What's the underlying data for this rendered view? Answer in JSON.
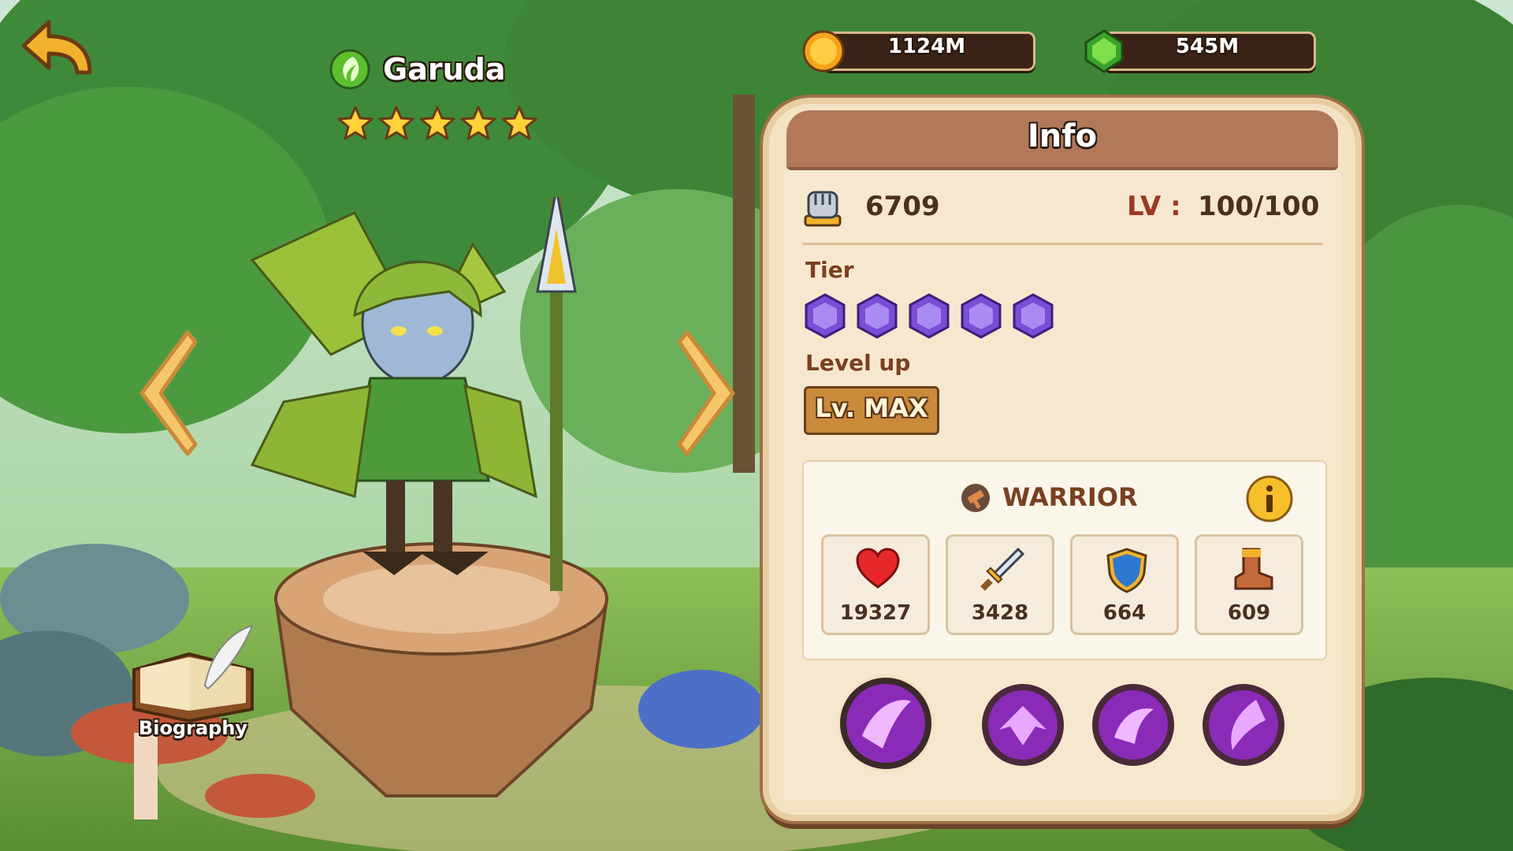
{
  "hero": {
    "name": "Garuda",
    "stars": 5,
    "element_icon": "nature-leaf-icon"
  },
  "currency": {
    "gold": "1124M",
    "gems": "545M"
  },
  "biography": {
    "label": "Biography"
  },
  "info": {
    "title": "Info",
    "power": "6709",
    "level_label": "LV :",
    "level": "100/100",
    "tier_label": "Tier",
    "tier_count": 5,
    "levelup_label": "Level up",
    "levelup_button": "Lv. MAX",
    "class_name": "WARRIOR",
    "stats": {
      "hp": "19327",
      "attack": "3428",
      "defense": "664",
      "speed": "609"
    }
  },
  "skills": [
    "skill-1-icon",
    "skill-2-icon",
    "skill-3-icon",
    "skill-4-icon"
  ],
  "colors": {
    "panel": "#f3e3c4",
    "header": "#b1795a",
    "skill_purple": "#8a2bb8",
    "gem_purple": "#7a4dd6"
  }
}
